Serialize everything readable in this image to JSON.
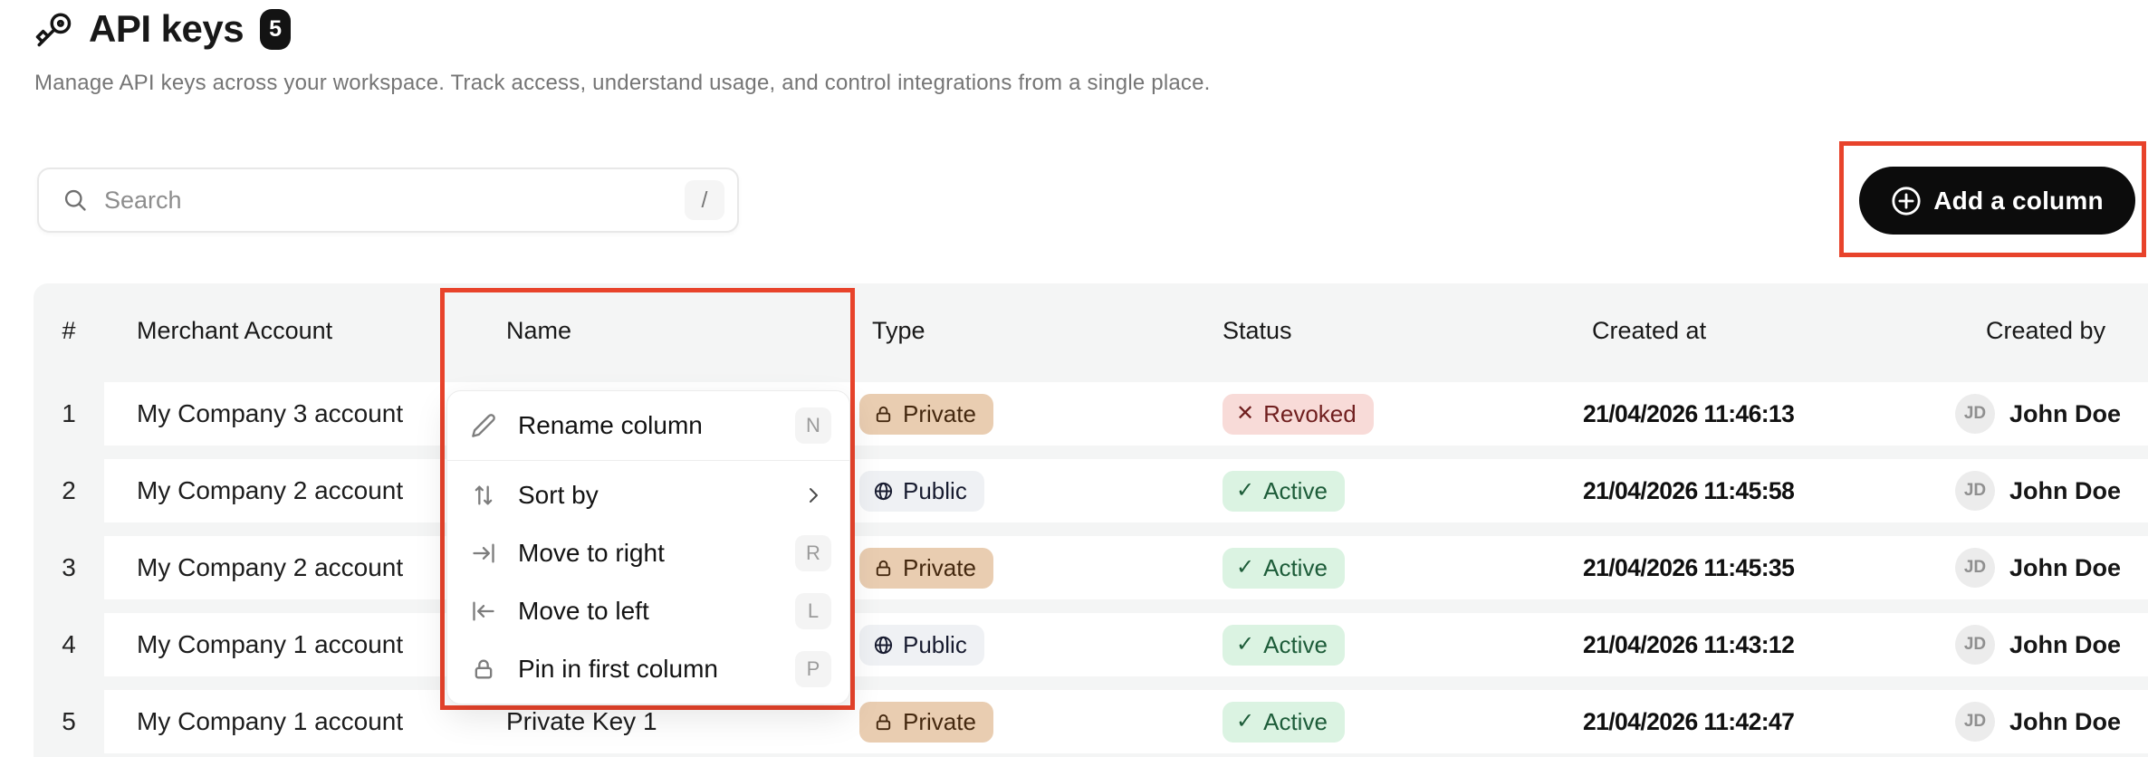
{
  "page": {
    "title": "API keys",
    "count_badge": "5",
    "subtitle": "Manage API keys across your workspace. Track access, understand usage, and control integrations from a single place."
  },
  "toolbar": {
    "search_placeholder": "Search",
    "search_shortcut": "/",
    "add_column_label": "Add a column"
  },
  "table": {
    "columns": {
      "index": "#",
      "merchant_account": "Merchant Account",
      "name": "Name",
      "type": "Type",
      "status": "Status",
      "created_at": "Created at",
      "created_by": "Created by"
    },
    "rows": [
      {
        "index": "1",
        "merchant_account": "My Company 3 account",
        "name": "",
        "type": "Private",
        "status": "Revoked",
        "created_at": "21/04/2026 11:46:13",
        "created_by_initials": "JD",
        "created_by": "John Doe"
      },
      {
        "index": "2",
        "merchant_account": "My Company 2 account",
        "name": "",
        "type": "Public",
        "status": "Active",
        "created_at": "21/04/2026 11:45:58",
        "created_by_initials": "JD",
        "created_by": "John Doe"
      },
      {
        "index": "3",
        "merchant_account": "My Company 2 account",
        "name": "",
        "type": "Private",
        "status": "Active",
        "created_at": "21/04/2026 11:45:35",
        "created_by_initials": "JD",
        "created_by": "John Doe"
      },
      {
        "index": "4",
        "merchant_account": "My Company 1 account",
        "name": "",
        "type": "Public",
        "status": "Active",
        "created_at": "21/04/2026 11:43:12",
        "created_by_initials": "JD",
        "created_by": "John Doe"
      },
      {
        "index": "5",
        "merchant_account": "My Company 1 account",
        "name": "Private Key 1",
        "type": "Private",
        "status": "Active",
        "created_at": "21/04/2026 11:42:47",
        "created_by_initials": "JD",
        "created_by": "John Doe"
      }
    ],
    "status_glyphs": {
      "active": "✓",
      "revoked": "✕"
    }
  },
  "context_menu": {
    "items": [
      {
        "label": "Rename column",
        "shortcut": "N",
        "icon": "pencil-icon"
      },
      {
        "label": "Sort by",
        "shortcut": "",
        "icon": "sort-icon",
        "has_submenu": true
      },
      {
        "label": "Move to right",
        "shortcut": "R",
        "icon": "arrow-to-right-icon"
      },
      {
        "label": "Move to left",
        "shortcut": "L",
        "icon": "arrow-to-left-icon"
      },
      {
        "label": "Pin in first column",
        "shortcut": "P",
        "icon": "lock-icon"
      }
    ]
  },
  "colors": {
    "annotation_red": "#e8432b",
    "button_black": "#0c0c0c",
    "table_gray": "#f4f5f5",
    "badge_private_bg": "#e9cdb1",
    "badge_public_bg": "#eff1f4",
    "badge_active_bg": "#dbf3e2",
    "badge_revoked_bg": "#f8dbd8"
  }
}
